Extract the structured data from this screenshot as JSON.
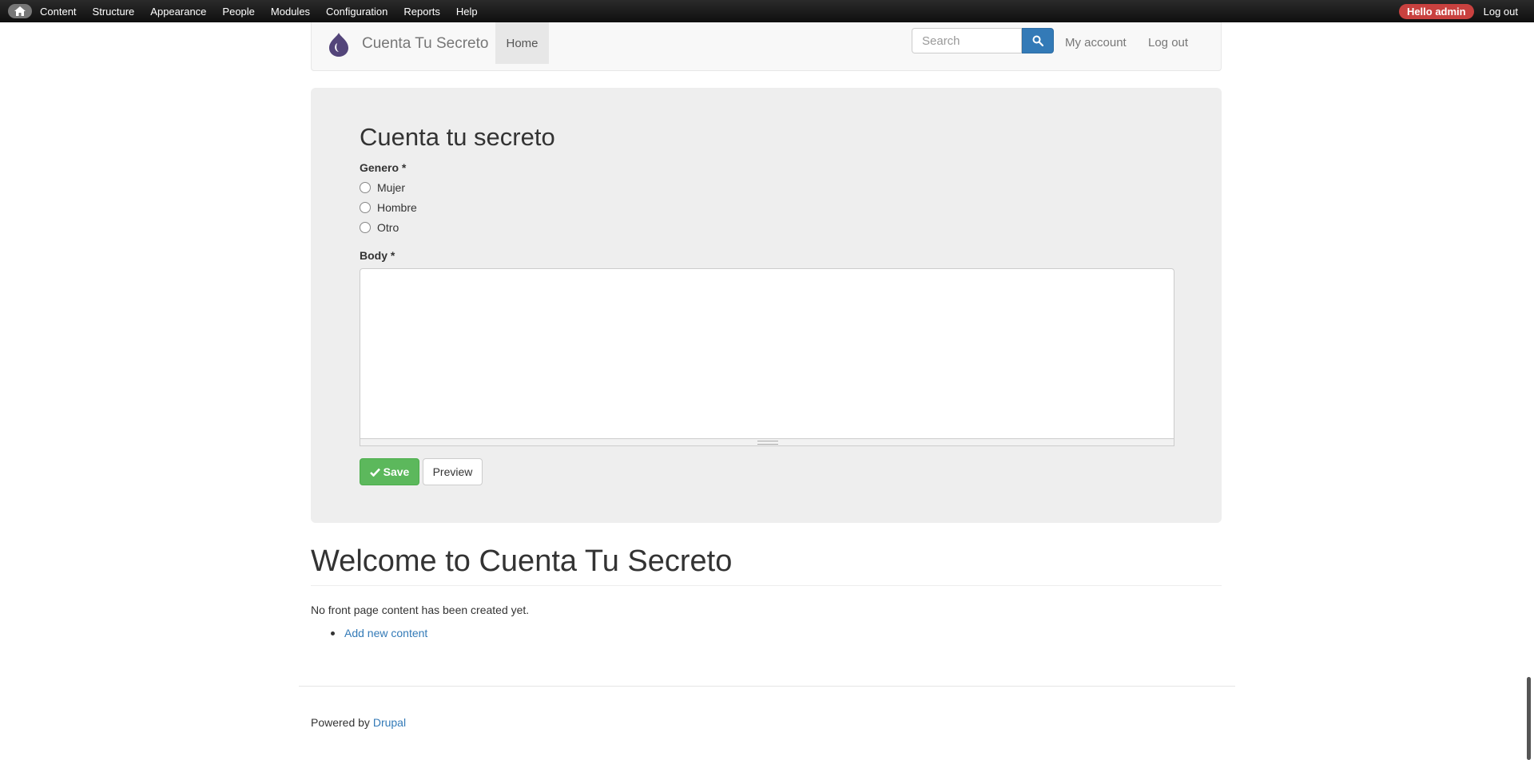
{
  "admin_bar": {
    "menu": [
      "Content",
      "Structure",
      "Appearance",
      "People",
      "Modules",
      "Configuration",
      "Reports",
      "Help"
    ],
    "hello": "Hello admin",
    "logout": "Log out"
  },
  "navbar": {
    "site_name": "Cuenta Tu Secreto",
    "home": "Home",
    "search_placeholder": "Search",
    "my_account": "My account",
    "logout": "Log out"
  },
  "form": {
    "title": "Cuenta tu secreto",
    "genero_label": "Genero *",
    "options": [
      "Mujer",
      "Hombre",
      "Otro"
    ],
    "body_label": "Body *",
    "body_value": "",
    "save": "Save",
    "preview": "Preview"
  },
  "content": {
    "welcome": "Welcome to Cuenta Tu Secreto",
    "no_content": "No front page content has been created yet.",
    "add_link": "Add new content"
  },
  "footer": {
    "powered_by": "Powered by",
    "drupal": "Drupal"
  },
  "colors": {
    "accent": "#337ab7",
    "save": "#5cb85c",
    "hello_badge": "#c9413f"
  }
}
